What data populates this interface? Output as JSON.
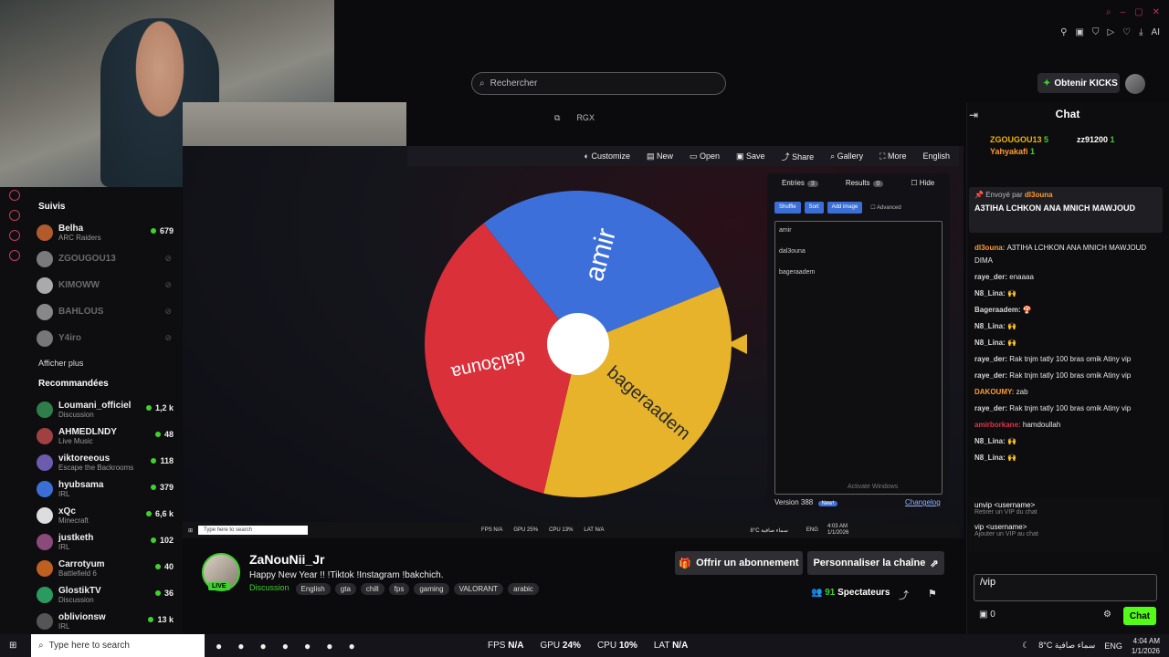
{
  "header": {
    "search_placeholder": "Rechercher",
    "kicks_button": "Obtenir KICKS",
    "toolbar_icons": [
      "pin-icon",
      "square-icon",
      "shield-icon",
      "play-icon",
      "heart-icon",
      "download-icon",
      "magic-icon"
    ],
    "ai_label": "AI"
  },
  "stream_overlay": {
    "rgx_label": "RGX",
    "wheel_toolbar": [
      "Customize",
      "New",
      "Open",
      "Save",
      "Share",
      "Gallery",
      "More",
      "English"
    ],
    "tabs": [
      {
        "label": "Entries",
        "count": "3"
      },
      {
        "label": "Results",
        "count": "0"
      }
    ],
    "hide_label": "Hide",
    "action_buttons": [
      "Shuffle",
      "Sort",
      "Add image",
      "Advanced"
    ],
    "entries": [
      "amir",
      "dal3ouna",
      "bageraadem"
    ],
    "wheel_segments": [
      {
        "label": "amir",
        "color": "#3c6fd9"
      },
      {
        "label": "bageraadem",
        "color": "#e6b32a"
      },
      {
        "label": "dal3ouna",
        "color": "#d9303a"
      }
    ],
    "version": "Version 388",
    "new_badge": "New!",
    "changelog": "Changelog",
    "watermark_title": "Activate Windows",
    "watermark_sub": "Go to Settings to activate Windows.",
    "inner_taskbar": {
      "search": "Type here to search",
      "stats": [
        "FPS N/A",
        "GPU 25%",
        "CPU 13%",
        "LAT N/A"
      ],
      "weather": "8°C سماء صافية",
      "lang": "ENG",
      "time": "4:03 AM",
      "date": "1/1/2026"
    }
  },
  "sidebar": {
    "followed_title": "Suivis",
    "followed": [
      {
        "name": "Belha",
        "sub": "ARC Raiders",
        "viewers": "679",
        "live": true
      },
      {
        "name": "ZGOUGOU13",
        "sub": "",
        "live": false
      },
      {
        "name": "KIMOWW",
        "sub": "",
        "live": false
      },
      {
        "name": "BAHLOUS",
        "sub": "",
        "live": false
      },
      {
        "name": "Y4iro",
        "sub": "",
        "live": false
      }
    ],
    "show_more": "Afficher plus",
    "recommended_title": "Recommandées",
    "recommended": [
      {
        "name": "Loumani_officiel",
        "sub": "Discussion",
        "viewers": "1,2 k"
      },
      {
        "name": "AHMEDLNDY",
        "sub": "Live Music",
        "viewers": "48"
      },
      {
        "name": "viktoreeous",
        "sub": "Escape the Backrooms",
        "viewers": "118"
      },
      {
        "name": "hyubsama",
        "sub": "IRL",
        "viewers": "379"
      },
      {
        "name": "xQc",
        "sub": "Minecraft",
        "viewers": "6,6 k"
      },
      {
        "name": "justketh",
        "sub": "IRL",
        "viewers": "102"
      },
      {
        "name": "Carrotyum",
        "sub": "Battlefield 6",
        "viewers": "40"
      },
      {
        "name": "GlostikTV",
        "sub": "Discussion",
        "viewers": "36"
      },
      {
        "name": "oblivionsw",
        "sub": "IRL",
        "viewers": "13 k"
      }
    ]
  },
  "channel": {
    "name": "ZaNouNii_Jr",
    "live_label": "LIVE",
    "title": "Happy New Year  !!  !Tiktok !Instagram !bakchich.",
    "category": "Discussion",
    "tags": [
      "English",
      "gta",
      "chill",
      "fps",
      "gaming",
      "VALORANT",
      "arabic"
    ],
    "subscribe_button": "Offrir un abonnement",
    "customize_button": "Personnaliser la chaîne",
    "viewers": "91",
    "viewers_label": "Spectateurs"
  },
  "chat": {
    "title": "Chat",
    "gifters": [
      {
        "name": "ZGOUGOU13",
        "count": "5"
      },
      {
        "name": "zz91200",
        "count": "1"
      },
      {
        "name": "Yahyakafi",
        "count": "1"
      }
    ],
    "pinned_by_label": "Envoyé par",
    "pinned_by": "dl3ouna",
    "pinned_text": "A3TIHA LCHKON ANA MNICH MAWJOUD",
    "messages": [
      {
        "user": "dl3ouna",
        "text": "A3TIHA LCHKON ANA MNICH MAWJOUD DIMA",
        "color": "#ff9a2e"
      },
      {
        "user": "raye_der",
        "text": "enaaaa",
        "color": "#d8d8d8"
      },
      {
        "user": "N8_Lina",
        "text": "🙌",
        "color": "#d8d8d8"
      },
      {
        "user": "Bageraadem",
        "text": "🍄",
        "color": "#d8d8d8"
      },
      {
        "user": "N8_Lina",
        "text": "🙌",
        "color": "#d8d8d8"
      },
      {
        "user": "N8_Lina",
        "text": "🙌",
        "color": "#d8d8d8"
      },
      {
        "user": "raye_der",
        "text": "Rak tnjm tatly 100 bras omik Atiny vip",
        "color": "#d8d8d8"
      },
      {
        "user": "raye_der",
        "text": "Rak tnjm tatly 100 bras omik Atiny vip",
        "color": "#d8d8d8"
      },
      {
        "user": "DAKOUMY",
        "text": "zab",
        "color": "#ff9a2e"
      },
      {
        "user": "raye_der",
        "text": "Rak tnjm tatly 100 bras omik Atiny vip",
        "color": "#d8d8d8"
      },
      {
        "user": "amirborkane",
        "text": "hamdoullah",
        "color": "#e0334a"
      },
      {
        "user": "N8_Lina",
        "text": "🙌",
        "color": "#d8d8d8"
      },
      {
        "user": "N8_Lina",
        "text": "🙌",
        "color": "#d8d8d8"
      }
    ],
    "commands": [
      {
        "cmd": "unvip <username>",
        "desc": "Retirer un VIP du chat"
      },
      {
        "cmd": "vip <username>",
        "desc": "Ajouter un VIP au chat"
      }
    ],
    "input_value": "/vip",
    "points": "0",
    "send_button": "Chat"
  },
  "taskbar": {
    "search": "Type here to search",
    "stats": [
      {
        "label": "FPS",
        "value": "N/A"
      },
      {
        "label": "GPU",
        "value": "24%"
      },
      {
        "label": "CPU",
        "value": "10%"
      },
      {
        "label": "LAT",
        "value": "N/A"
      }
    ],
    "weather": "8°C  سماء صافية",
    "lang": "ENG",
    "time": "4:04 AM",
    "date": "1/1/2026"
  },
  "colors": {
    "kick_green": "#53fc18",
    "accent_red": "#c23d55"
  }
}
